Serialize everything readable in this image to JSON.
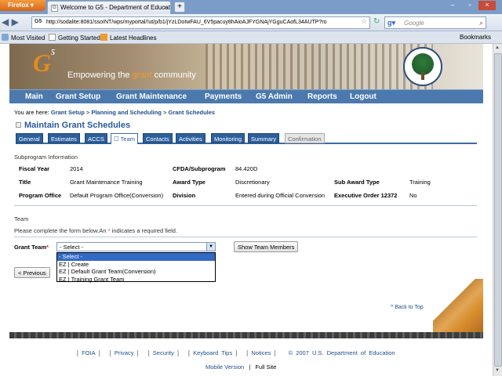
{
  "browser": {
    "menu_button": "Firefox",
    "tab_title": "Welcome to G5 - Department of Educatio...",
    "url": "http://sodalite:8081/ssoINT/wps/myportal/!ut/p/b1/jYzLDoIwFAU_6V5pacuy8hAioAJFYGNAjYGguCAofL34AUTP?ro",
    "search_placeholder": "Google",
    "bookmarks": [
      "Most Visited",
      "Getting Started",
      "Latest Headlines"
    ],
    "bookmarks_right": "Bookmarks"
  },
  "banner": {
    "logo": "G",
    "logo_sup": "5",
    "tagline_pre": "Empowering the ",
    "tagline_hl": "grant",
    "tagline_post": " community"
  },
  "mainnav": [
    "Main",
    "Grant Setup",
    "Grant Maintenance",
    "Payments",
    "G5 Admin",
    "Reports",
    "Logout"
  ],
  "breadcrumb": {
    "prefix": "You are here:",
    "items": [
      "Grant Setup",
      "Planning and Scheduling",
      "Grant Schedules"
    ]
  },
  "page_title": "Maintain Grant Schedules",
  "tabs": [
    "General",
    "Estimates",
    "ACCS",
    "Team",
    "Contacts",
    "Activities",
    "Monitoring",
    "Summary",
    "Confirmation"
  ],
  "subprogram": {
    "heading": "Subprogram Information",
    "fiscal_year_label": "Fiscal Year",
    "fiscal_year": "2014",
    "cfda_label": "CFDA/Subprogram",
    "cfda": "84.420D",
    "title_label": "Title",
    "title": "Grant Maintenance Training",
    "award_type_label": "Award Type",
    "award_type": "Discretionary",
    "sub_award_type_label": "Sub Award Type",
    "sub_award_type": "Training",
    "program_office_label": "Program Office",
    "program_office": "Default Program Office(Conversion)",
    "division_label": "Division",
    "division": "Entered during Official Conversion",
    "exec_order_label": "Executive Order 12372",
    "exec_order": "No"
  },
  "team": {
    "heading": "Team",
    "instructions_pre": "Please complete the form below.An ",
    "instructions_star": "*",
    "instructions_post": " indicates a required field.",
    "grant_team_label": "Grant Team",
    "required_star": "*",
    "selected": "- Select -",
    "options": [
      "- Select -",
      "EZ | Create",
      "EZ | Default Grant Team(Conversion)",
      "EZ | Training Grant Team"
    ],
    "show_members_button": "Show Team Members",
    "previous_button": "< Previous"
  },
  "back_to_top": "^ Back to Top",
  "footer": {
    "links": [
      "FOIA",
      "Privacy",
      "Security",
      "Keyboard Tips",
      "Notices"
    ],
    "copyright": "© 2007 U.S. Department of Education",
    "mobile": "Mobile Version",
    "sep": "|",
    "full": "Full Site"
  }
}
